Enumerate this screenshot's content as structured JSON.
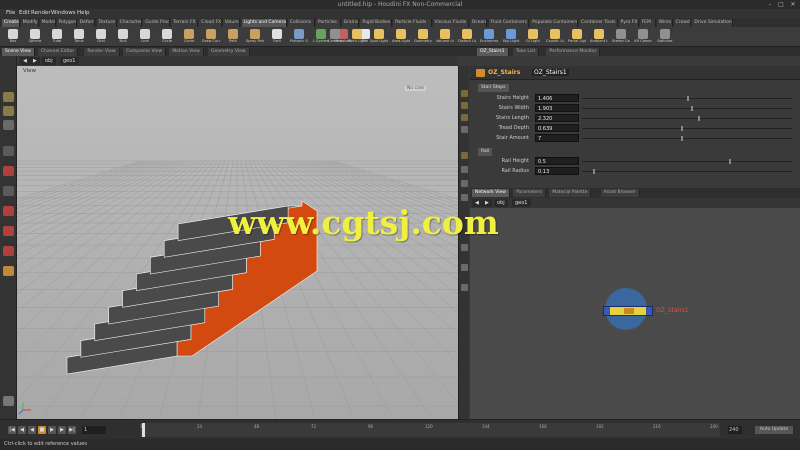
{
  "window": {
    "title": "untitled.hip - Houdini FX Non-Commercial"
  },
  "menu": [
    "File",
    "Edit",
    "Render",
    "Windows",
    "Help"
  ],
  "shelf_tabs": [
    "Create",
    "Modify",
    "Model",
    "Polygon",
    "Deform",
    "Texture",
    "Character",
    "Guide Proc",
    "Terrain FX",
    "Cloud FX",
    "Volume",
    "Lights and Cameras",
    "Collisions",
    "Particles",
    "Grains",
    "Rigid Bodies",
    "Particle Fluids",
    "Viscous Fluids",
    "Oceans",
    "Fluid Containers",
    "Populate Containers",
    "Container Tools",
    "Pyro FX",
    "FEM",
    "Wires",
    "Crowds",
    "Drive Simulation"
  ],
  "shelf_tools_left": [
    {
      "label": "Box",
      "color": "#d8d8d8"
    },
    {
      "label": "Sphere",
      "color": "#d8d8d8"
    },
    {
      "label": "Tube",
      "color": "#d8d8d8"
    },
    {
      "label": "Torus",
      "color": "#d8d8d8"
    },
    {
      "label": "Grid",
      "color": "#d8d8d8"
    },
    {
      "label": "Null",
      "color": "#d8d8d8"
    },
    {
      "label": "Line",
      "color": "#d8d8d8"
    },
    {
      "label": "Circle",
      "color": "#d8d8d8"
    },
    {
      "label": "Curve",
      "color": "#c8a060"
    },
    {
      "label": "Draw Curve",
      "color": "#c8a060"
    },
    {
      "label": "Path",
      "color": "#c8a060"
    },
    {
      "label": "Spray Paint",
      "color": "#c8a060"
    },
    {
      "label": "Font",
      "color": "#e0e0e0"
    },
    {
      "label": "Platonic Solids",
      "color": "#7a9ac8"
    },
    {
      "label": "L-System",
      "color": "#6aa060"
    },
    {
      "label": "Metaball",
      "color": "#c06060"
    },
    {
      "label": "File",
      "color": "#e8e8e8"
    }
  ],
  "shelf_tools_right": [
    {
      "label": "Camera",
      "color": "#909090"
    },
    {
      "label": "Point Light",
      "color": "#e8c060"
    },
    {
      "label": "Spot Light",
      "color": "#e8c060"
    },
    {
      "label": "Area Light",
      "color": "#e8c060"
    },
    {
      "label": "Geometry Light",
      "color": "#e8c060"
    },
    {
      "label": "Volume Light",
      "color": "#e8c060"
    },
    {
      "label": "Distant Light",
      "color": "#e8c060"
    },
    {
      "label": "Environment Light",
      "color": "#6a9ad8"
    },
    {
      "label": "Sky Light",
      "color": "#6a9ad8"
    },
    {
      "label": "GI Light",
      "color": "#e8c060"
    },
    {
      "label": "Caustic Light",
      "color": "#e8c060"
    },
    {
      "label": "Portal Light",
      "color": "#e8c060"
    },
    {
      "label": "Ambient Light",
      "color": "#e8c060"
    },
    {
      "label": "Stereo Camera",
      "color": "#909090"
    },
    {
      "label": "VR Camera",
      "color": "#909090"
    },
    {
      "label": "Switcher",
      "color": "#909090"
    }
  ],
  "left_pane_tabs": [
    "Scene View",
    "Channel Editor",
    "Render View",
    "Composite View",
    "Motion View",
    "Geometry View"
  ],
  "right_pane_tabs": [
    "OZ_Stairs1",
    "Take List",
    "Performance Monitor"
  ],
  "path": {
    "context": "obj",
    "node": "geo1"
  },
  "viewport": {
    "label": "View",
    "camera": "No cam"
  },
  "node": {
    "type": "OZ_Stairs",
    "name": "OZ_Stairs1"
  },
  "param_tabs": [
    "Stair Steps",
    "Rail"
  ],
  "params": [
    {
      "label": "Stairs Height",
      "value": "1.406",
      "pos": 0.5
    },
    {
      "label": "Stairs Width",
      "value": "1.903",
      "pos": 0.52
    },
    {
      "label": "Stairs Length",
      "value": "2.320",
      "pos": 0.55
    },
    {
      "label": "Tread Depth",
      "value": "0.639",
      "pos": 0.47
    },
    {
      "label": "Stair Amount",
      "value": "7",
      "pos": 0.47
    }
  ],
  "rail_params": [
    {
      "label": "Rail Height",
      "value": "0.5",
      "pos": 0.7
    },
    {
      "label": "Rail Radius",
      "value": "0.13",
      "pos": 0.05
    }
  ],
  "network_tabs": [
    "Network View",
    "Parameters",
    "Material Palette",
    "Asset Browser"
  ],
  "network_node_label": "OZ_Stairs1",
  "watermark": "www.cgtsj.com",
  "timeline": {
    "ticks": [
      "1",
      "24",
      "48",
      "72",
      "96",
      "120",
      "144",
      "168",
      "192",
      "216",
      "240"
    ],
    "current": "1",
    "end": "240"
  },
  "status": "Ctrl-click to edit reference values",
  "colors": {
    "stair_side": "#d24a10",
    "stair_top": "#5a5a5a",
    "accent": "#ffb347"
  }
}
